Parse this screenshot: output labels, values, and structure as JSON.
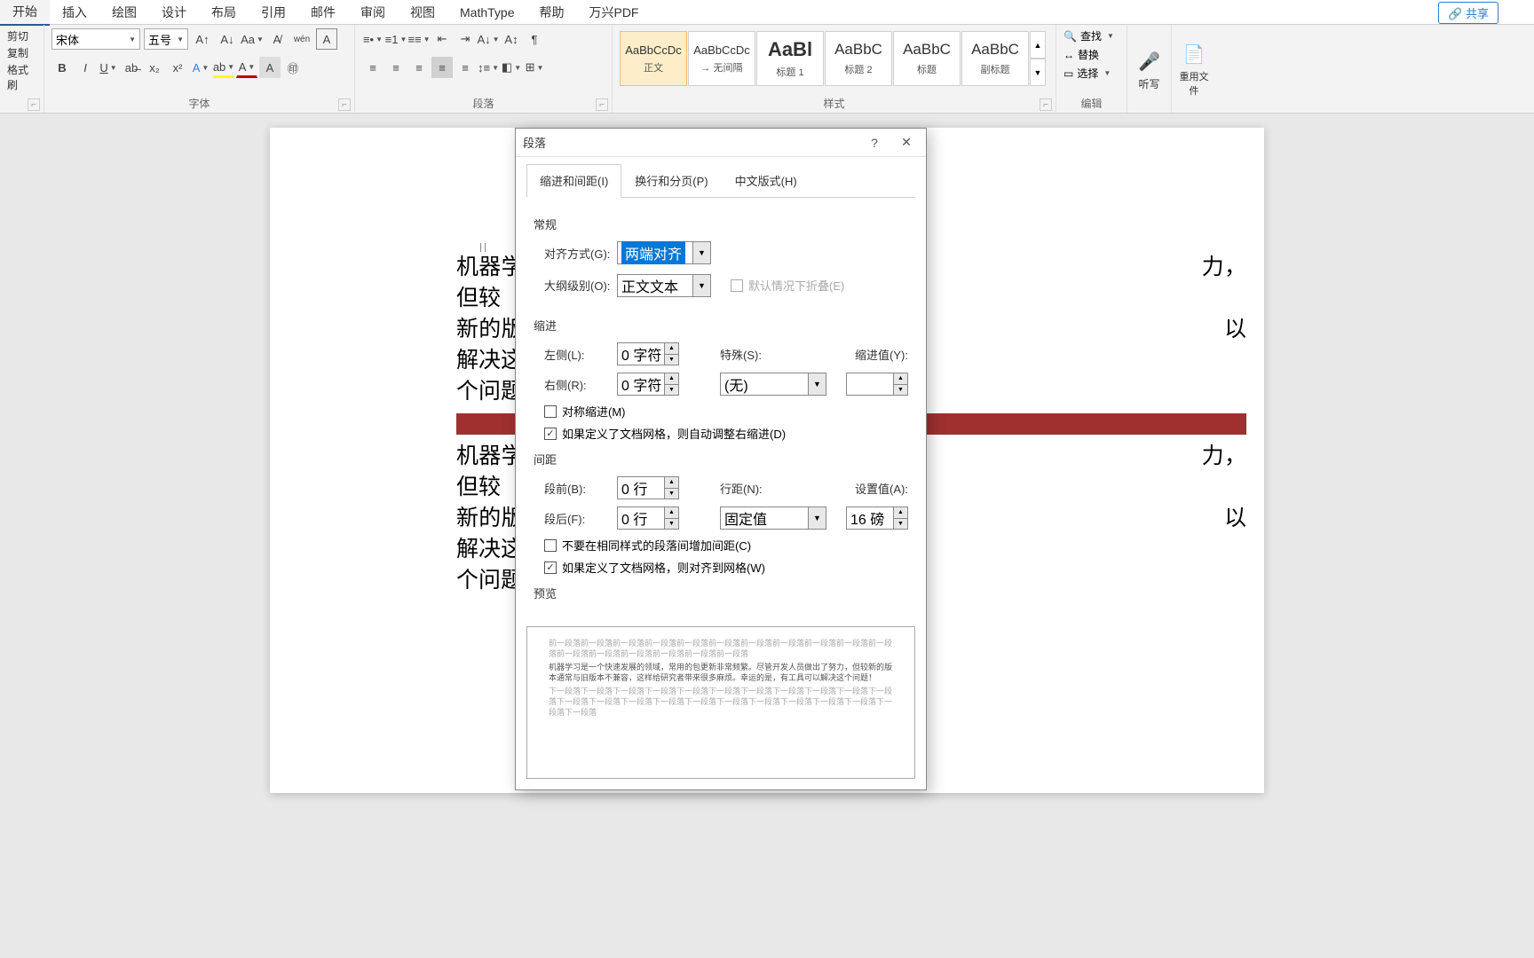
{
  "ribbon": {
    "tabs": [
      "开始",
      "插入",
      "绘图",
      "设计",
      "布局",
      "引用",
      "邮件",
      "审阅",
      "视图",
      "MathType",
      "帮助",
      "万兴PDF"
    ],
    "share": "共享",
    "clipboard": {
      "cut": "剪切",
      "copy": "复制",
      "paste": "格式刷"
    },
    "font": {
      "name": "宋体",
      "size": "五号",
      "groupLabel": "字体"
    },
    "paragraph": {
      "groupLabel": "段落"
    },
    "styles": {
      "groupLabel": "样式",
      "items": [
        {
          "preview": "AaBbCcDc",
          "name": "正文"
        },
        {
          "preview": "AaBbCcDc",
          "name": "无间隔"
        },
        {
          "preview": "AaBl",
          "name": "标题 1"
        },
        {
          "preview": "AaBbC",
          "name": "标题 2"
        },
        {
          "preview": "AaBbC",
          "name": "标题"
        },
        {
          "preview": "AaBbC",
          "name": "副标题"
        }
      ]
    },
    "edit": {
      "groupLabel": "编辑",
      "find": "查找",
      "replace": "替换",
      "select": "选择"
    },
    "dictate": "听写",
    "reuse": "重用文件"
  },
  "document": {
    "para1": "机器学习是一个快速发展的领域，",
    "para1b": "力，但较新的版本通常与旧版本不兼容，这样",
    "para1c": "以解决这个问题！",
    "para2": "机器学习是一个快速发展的领域，",
    "para2b": "力，但较新的版本通常与旧版本不兼容，这样",
    "para2c": "以解决这个问题！"
  },
  "dialog": {
    "title": "段落",
    "tabs": [
      "缩进和间距(I)",
      "换行和分页(P)",
      "中文版式(H)"
    ],
    "general": "常规",
    "alignLabel": "对齐方式(G):",
    "alignValue": "两端对齐",
    "outlineLabel": "大纲级别(O):",
    "outlineValue": "正文文本",
    "collapseLabel": "默认情况下折叠(E)",
    "indent": "缩进",
    "leftLabel": "左侧(L):",
    "leftValue": "0 字符",
    "rightLabel": "右侧(R):",
    "rightValue": "0 字符",
    "specialLabel": "特殊(S):",
    "specialValue": "(无)",
    "indentByLabel": "缩进值(Y):",
    "mirrorLabel": "对称缩进(M)",
    "autoRightLabel": "如果定义了文档网格，则自动调整右缩进(D)",
    "spacing": "间距",
    "beforeLabel": "段前(B):",
    "beforeValue": "0 行",
    "afterLabel": "段后(F):",
    "afterValue": "0 行",
    "lineSpLabel": "行距(N):",
    "lineSpValue": "固定值",
    "atLabel": "设置值(A):",
    "atValue": "16 磅",
    "noSpaceSameLabel": "不要在相同样式的段落间增加间距(C)",
    "snapGridLabel": "如果定义了文档网格，则对齐到网格(W)",
    "preview": "预览",
    "previewDummy": "前一段落前一段落前一段落前一段落前一段落前一段落前一段落前一段落前一段落前一段落前一段落前一段落前一段落前一段落前一段落前一段落前一段落",
    "previewMain": "机器学习是一个快速发展的领域，常用的包更新非常频繁。尽管开发人员做出了努力，但较新的版本通常与旧版本不兼容，这样给研究者带来很多麻烦。幸运的是，有工具可以解决这个问题！",
    "previewAfter": "下一段落下一段落下一段落下一段落下一段落下一段落下一段落下一段落下一段落下一段落下一段落下一段落下一段落下一段落下一段落下一段落下一段落下一段落下一段落下一段落下一段落下一段落下一段落"
  }
}
